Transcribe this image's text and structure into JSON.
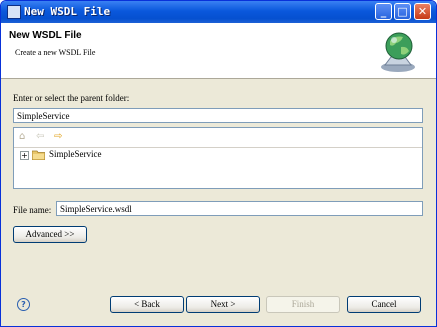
{
  "window": {
    "title": "New WSDL File"
  },
  "header": {
    "title": "New WSDL File",
    "description": "Create a new WSDL File"
  },
  "parent_folder": {
    "label": "Enter or select the parent folder:",
    "value": "SimpleService"
  },
  "tree": {
    "items": [
      {
        "label": "SimpleService",
        "expander": "+"
      }
    ]
  },
  "file_name": {
    "label": "File name:",
    "value": "SimpleService.wsdl"
  },
  "buttons": {
    "advanced": "Advanced >>",
    "back": "< Back",
    "next": "Next >",
    "finish": "Finish",
    "cancel": "Cancel"
  },
  "colors": {
    "titlebar": "#0a58dc",
    "dialog_bg": "#ece9d8",
    "disabled_text": "#aca899"
  }
}
